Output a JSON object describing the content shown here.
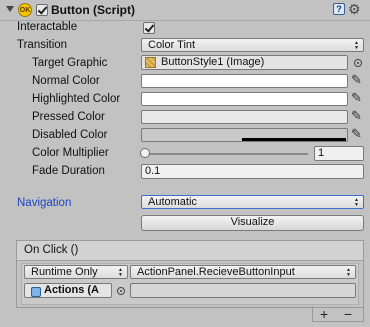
{
  "header": {
    "title": "Button (Script)",
    "ok_badge": "OK",
    "enabled": true,
    "help_label": "?",
    "settings_glyph": "⚙"
  },
  "props": {
    "interactable": {
      "label": "Interactable",
      "checked": true
    },
    "transition": {
      "label": "Transition",
      "value": "Color Tint"
    },
    "target_graphic": {
      "label": "Target Graphic",
      "value": "ButtonStyle1 (Image)"
    },
    "normal_color": {
      "label": "Normal Color",
      "hex": "#ffffff"
    },
    "highlighted_color": {
      "label": "Highlighted Color",
      "hex": "#ffffff"
    },
    "pressed_color": {
      "label": "Pressed Color",
      "hex": "#e8e8e8"
    },
    "disabled_color": {
      "label": "Disabled Color",
      "hex": "#c8c8c8"
    },
    "color_multiplier": {
      "label": "Color Multiplier",
      "value": "1",
      "level": 0
    },
    "fade_duration": {
      "label": "Fade Duration",
      "value": "0.1"
    },
    "navigation": {
      "label": "Navigation",
      "value": "Automatic"
    },
    "visualize": {
      "label": "Visualize"
    }
  },
  "on_click": {
    "title": "On Click ()",
    "runtime": "Runtime Only",
    "function": "ActionPanel.RecieveButtonInput",
    "object": "Actions (A",
    "argument": ""
  },
  "footer": {
    "add": "+",
    "remove": "−"
  },
  "colors": {
    "background": "#c2c2c2",
    "navigation_label": "#1a47c2",
    "badge": "#f5c400"
  }
}
